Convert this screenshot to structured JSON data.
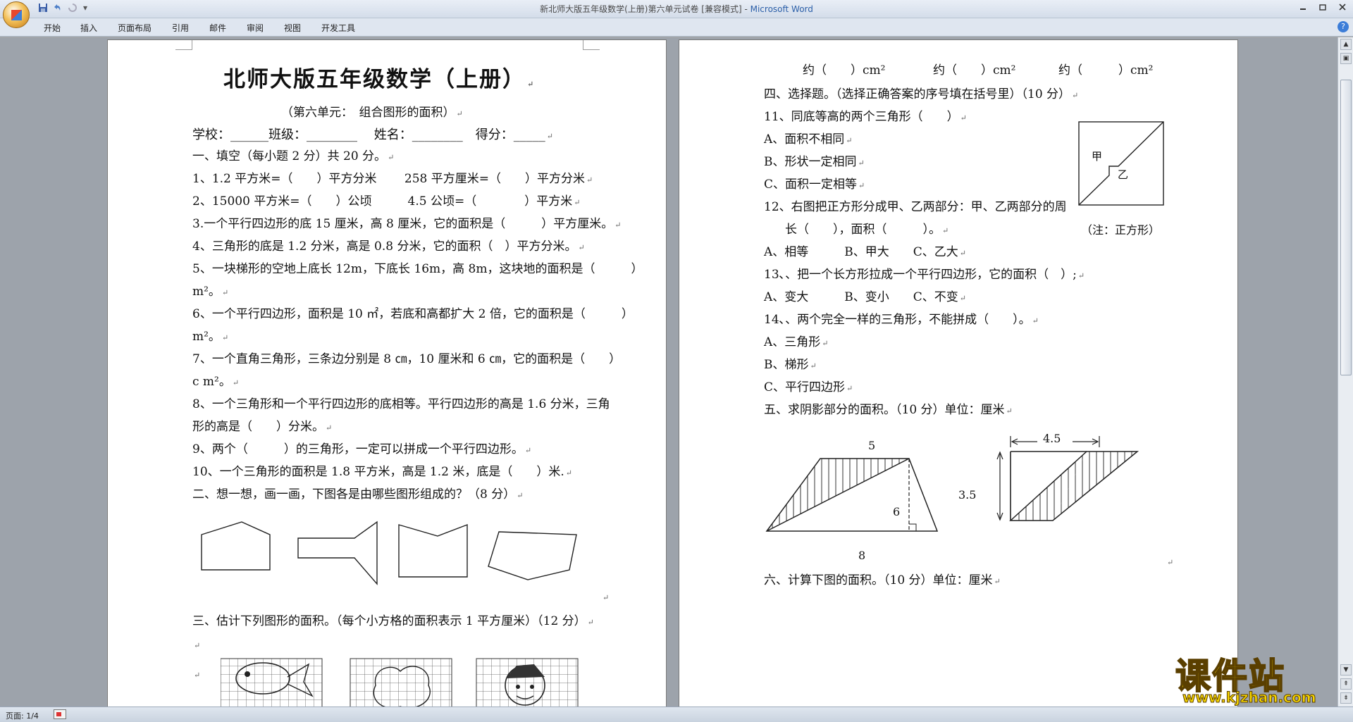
{
  "window": {
    "title_doc": "新北师大版五年级数学(上册)第六单元试卷 [兼容模式] - ",
    "title_app": "Microsoft Word",
    "qat_more": "▾"
  },
  "ribbon_tabs": [
    "开始",
    "插入",
    "页面布局",
    "引用",
    "邮件",
    "审阅",
    "视图",
    "开发工具"
  ],
  "help_label": "?",
  "page1": {
    "title": "北师大版五年级数学（上册）",
    "subtitle": "（第六单元：　组合图形的面积）",
    "info": "学校：______班级：________　 姓名：________　得分：_____",
    "sec1": "一、填空（每小题 2 分）共 20 分。",
    "q1": "1、1.2 平方米=（　　）平方分米　　 258 平方厘米=（　　）平方分米",
    "q2": "2、15000 平方米=（　　）公顷　　　4.5 公顷=（　　　　）平方米",
    "q3": "3.一个平行四边形的底 15 厘米，高 8 厘米，它的面积是（　　　）平方厘米。",
    "q4": "4、三角形的底是 1.2 分米，高是 0.8 分米，它的面积（　）平方分米。",
    "q5a": "5、一块梯形的空地上底长 12m，下底长 16m，高 8m，这块地的面积是（　　　）",
    "q5b": "m²。",
    "q6a": "6、一个平行四边形，面积是 10 ㎡，若底和高都扩大 2 倍，它的面积是（　　　）",
    "q6b": "m²。",
    "q7a": "7、一个直角三角形，三条边分别是 8 ㎝，10 厘米和 6 ㎝，它的面积是（　　）",
    "q7b": "c m²。",
    "q8a": "8、一个三角形和一个平行四边形的底相等。平行四边形的高是 1.6 分米，三角",
    "q8b": "形的高是（　　）分米。",
    "q9": "9、两个（　　　）的三角形，一定可以拼成一个平行四边形。",
    "q10": "10、一个三角形的面积是 1.8 平方米，高是 1.2 米，底是（　　）米.",
    "sec2": "二、想一想，画一画，下图各是由哪些图形组成的？（8 分）",
    "sec3": "三、估计下列图形的面积。（每个小方格的面积表示 1 平方厘米）（12 分）"
  },
  "page2": {
    "approx1": "约（　　）cm²",
    "approx2": "约（　　）cm²",
    "approx3": "约（　　　）cm²",
    "sec4": "四、选择题。（选择正确答案的序号填在括号里）（10 分）",
    "q11": "11、同底等高的两个三角形（　　）",
    "q11a": "A、面积不相同",
    "q11b": "B、形状一定相同",
    "q11c": "C、面积一定相等",
    "q12a": "12、右图把正方形分成甲、乙两部分：甲、乙两部分的周",
    "q12b": "长（　　），面积（　　　）。",
    "q12opts": "A、相等　　　B、甲大　　C、乙大",
    "q13": "13､、把一个长方形拉成一个平行四边形，它的面积（　）;",
    "q13opts": "A、变大　　　B、变小　　C、不变",
    "q14": "14､、两个完全一样的三角形，不能拼成（　　）。",
    "q14a": "A、三角形",
    "q14b": "B、梯形",
    "q14c": "C、平行四边形",
    "sec5": "五、求阴影部分的面积。（10 分）单位：厘米",
    "sec6": "六、计算下图的面积。（10 分）单位：厘米",
    "fig_label_jia": "甲",
    "fig_label_yi": "乙",
    "fig_note": "（注：正方形）",
    "trap_top": "5",
    "trap_h": "6",
    "trap_bottom": "8",
    "para_top": "4.5",
    "para_h": "3.5"
  },
  "status": {
    "page": "页面: 1/4"
  },
  "watermark": {
    "main": "课件站",
    "sub": "www.kjzhan.com"
  }
}
